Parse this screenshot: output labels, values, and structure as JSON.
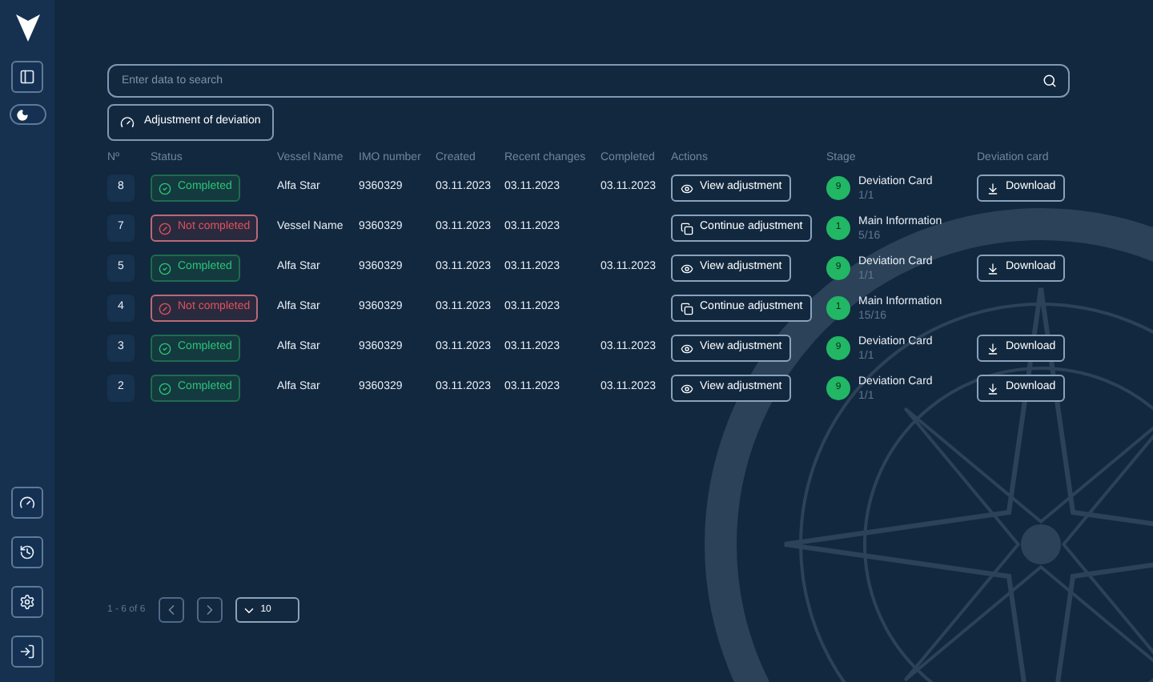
{
  "theme_toggle": {
    "on": true
  },
  "search": {
    "placeholder": "Enter data to search"
  },
  "deviation_button": {
    "label": "Adjustment of deviation"
  },
  "table": {
    "columns": [
      "Nº",
      "Status",
      "Vessel Name",
      "IMO number",
      "Created",
      "Recent changes",
      "Completed",
      "Actions",
      "Stage",
      "Deviation card"
    ],
    "rows": [
      {
        "number": "8",
        "status": {
          "kind": "completed",
          "label": "Completed"
        },
        "vessel": "Alfa Star",
        "imo": "9360329",
        "created": "03.11.2023",
        "recent": "03.11.2023",
        "completed": "03.11.2023",
        "action": {
          "kind": "view",
          "label": "View adjustment"
        },
        "stage": {
          "number": "9",
          "title": "Deviation Card",
          "progress": "1/1"
        },
        "download": "Download"
      },
      {
        "number": "7",
        "status": {
          "kind": "not_completed",
          "label": "Not completed"
        },
        "vessel": "Vessel Name",
        "imo": "9360329",
        "created": "03.11.2023",
        "recent": "03.11.2023",
        "action": {
          "kind": "continue",
          "label": "Continue adjustment"
        },
        "stage": {
          "number": "1",
          "title": "Main Information",
          "progress": "5/16"
        }
      },
      {
        "number": "5",
        "status": {
          "kind": "completed",
          "label": "Completed"
        },
        "vessel": "Alfa Star",
        "imo": "9360329",
        "created": "03.11.2023",
        "recent": "03.11.2023",
        "completed": "03.11.2023",
        "action": {
          "kind": "view",
          "label": "View adjustment"
        },
        "stage": {
          "number": "9",
          "title": "Deviation Card",
          "progress": "1/1"
        },
        "download": "Download"
      },
      {
        "number": "4",
        "status": {
          "kind": "not_completed",
          "label": "Not completed"
        },
        "vessel": "Alfa Star",
        "imo": "9360329",
        "created": "03.11.2023",
        "recent": "03.11.2023",
        "action": {
          "kind": "continue",
          "label": "Continue adjustment"
        },
        "stage": {
          "number": "1",
          "title": "Main Information",
          "progress": "15/16"
        }
      },
      {
        "number": "3",
        "status": {
          "kind": "completed",
          "label": "Completed"
        },
        "vessel": "Alfa Star",
        "imo": "9360329",
        "created": "03.11.2023",
        "recent": "03.11.2023",
        "completed": "03.11.2023",
        "action": {
          "kind": "view",
          "label": "View adjustment"
        },
        "stage": {
          "number": "9",
          "title": "Deviation Card",
          "progress": "1/1"
        },
        "download": "Download"
      },
      {
        "number": "2",
        "status": {
          "kind": "completed",
          "label": "Completed"
        },
        "vessel": "Alfa Star",
        "imo": "9360329",
        "created": "03.11.2023",
        "recent": "03.11.2023",
        "completed": "03.11.2023",
        "action": {
          "kind": "view",
          "label": "View adjustment"
        },
        "stage": {
          "number": "9",
          "title": "Deviation Card",
          "progress": "1/1"
        },
        "download": "Download"
      }
    ]
  },
  "pagination": {
    "range": "1 - 6 of 6",
    "page_size": "10"
  }
}
